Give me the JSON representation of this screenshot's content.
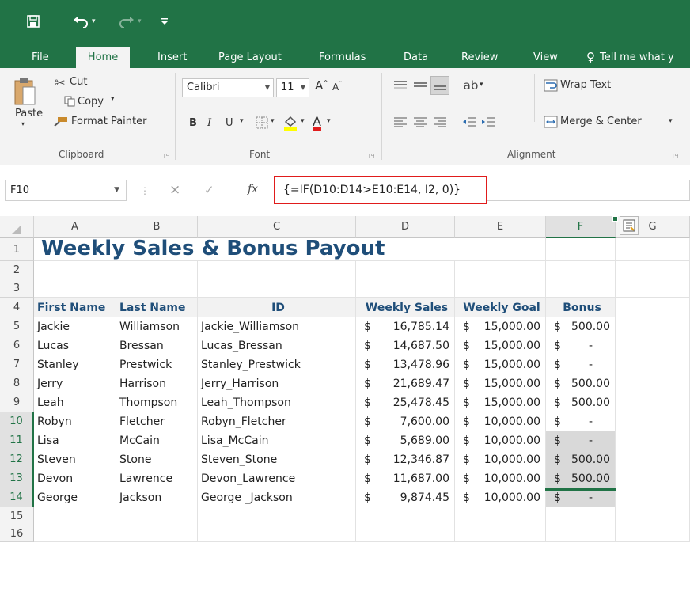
{
  "titlebar": {
    "save_icon": "save-icon",
    "undo_icon": "undo-icon",
    "redo_icon": "redo-icon",
    "customize_icon": "customize-qat-icon"
  },
  "tabs": [
    "File",
    "Home",
    "Insert",
    "Page Layout",
    "Formulas",
    "Data",
    "Review",
    "View"
  ],
  "tell_me": "Tell me what y",
  "ribbon": {
    "clipboard": {
      "paste": "Paste",
      "cut": "Cut",
      "copy": "Copy",
      "format_painter": "Format Painter",
      "label": "Clipboard"
    },
    "font": {
      "name": "Calibri",
      "size": "11",
      "bold": "B",
      "italic": "I",
      "underline": "U",
      "font_color_letter": "A",
      "grow": "A",
      "shrink": "A",
      "label": "Font"
    },
    "alignment": {
      "wrap_text": "Wrap Text",
      "merge_center": "Merge & Center",
      "label": "Alignment"
    }
  },
  "formula_bar": {
    "name_box": "F10",
    "cancel": "×",
    "enter": "✓",
    "fx": "fx",
    "formula": "{=IF(D10:D14>E10:E14, I2, 0)}"
  },
  "columns": [
    "A",
    "B",
    "C",
    "D",
    "E",
    "F",
    "G"
  ],
  "rows": [
    "1",
    "2",
    "3",
    "4",
    "5",
    "6",
    "7",
    "8",
    "9",
    "10",
    "11",
    "12",
    "13",
    "14",
    "15",
    "16"
  ],
  "sheet": {
    "title": "Weekly Sales & Bonus Payout",
    "headers": [
      "First Name",
      "Last Name",
      "ID",
      "Weekly Sales",
      "Weekly Goal",
      "Bonus"
    ],
    "records": [
      {
        "first": "Jackie",
        "last": "Williamson",
        "id": "Jackie_Williamson",
        "sales": "16,785.14",
        "goal": "15,000.00",
        "bonus": "500.00"
      },
      {
        "first": "Lucas",
        "last": "Bressan",
        "id": "Lucas_Bressan",
        "sales": "14,687.50",
        "goal": "15,000.00",
        "bonus": "-"
      },
      {
        "first": "Stanley",
        "last": "Prestwick",
        "id": "Stanley_Prestwick",
        "sales": "13,478.96",
        "goal": "15,000.00",
        "bonus": "-"
      },
      {
        "first": "Jerry",
        "last": "Harrison",
        "id": "Jerry_Harrison",
        "sales": "21,689.47",
        "goal": "15,000.00",
        "bonus": "500.00"
      },
      {
        "first": "Leah",
        "last": "Thompson",
        "id": "Leah_Thompson",
        "sales": "25,478.45",
        "goal": "15,000.00",
        "bonus": "500.00"
      },
      {
        "first": "Robyn",
        "last": "Fletcher",
        "id": "Robyn_Fletcher",
        "sales": "7,600.00",
        "goal": "10,000.00",
        "bonus": "-"
      },
      {
        "first": "Lisa",
        "last": "McCain",
        "id": "Lisa_McCain",
        "sales": "5,689.00",
        "goal": "10,000.00",
        "bonus": "-"
      },
      {
        "first": "Steven",
        "last": "Stone",
        "id": "Steven_Stone",
        "sales": "12,346.87",
        "goal": "10,000.00",
        "bonus": "500.00"
      },
      {
        "first": "Devon",
        "last": "Lawrence",
        "id": "Devon_Lawrence",
        "sales": "11,687.00",
        "goal": "10,000.00",
        "bonus": "500.00"
      },
      {
        "first": "George",
        "last": "Jackson",
        "id": "George _Jackson",
        "sales": "9,874.45",
        "goal": "10,000.00",
        "bonus": "-"
      }
    ],
    "currency": "$"
  },
  "colors": {
    "excel_green": "#217346",
    "title_blue": "#1f4e79",
    "highlight_red": "#e01b1b",
    "selection_shade": "#d9d9d9"
  }
}
